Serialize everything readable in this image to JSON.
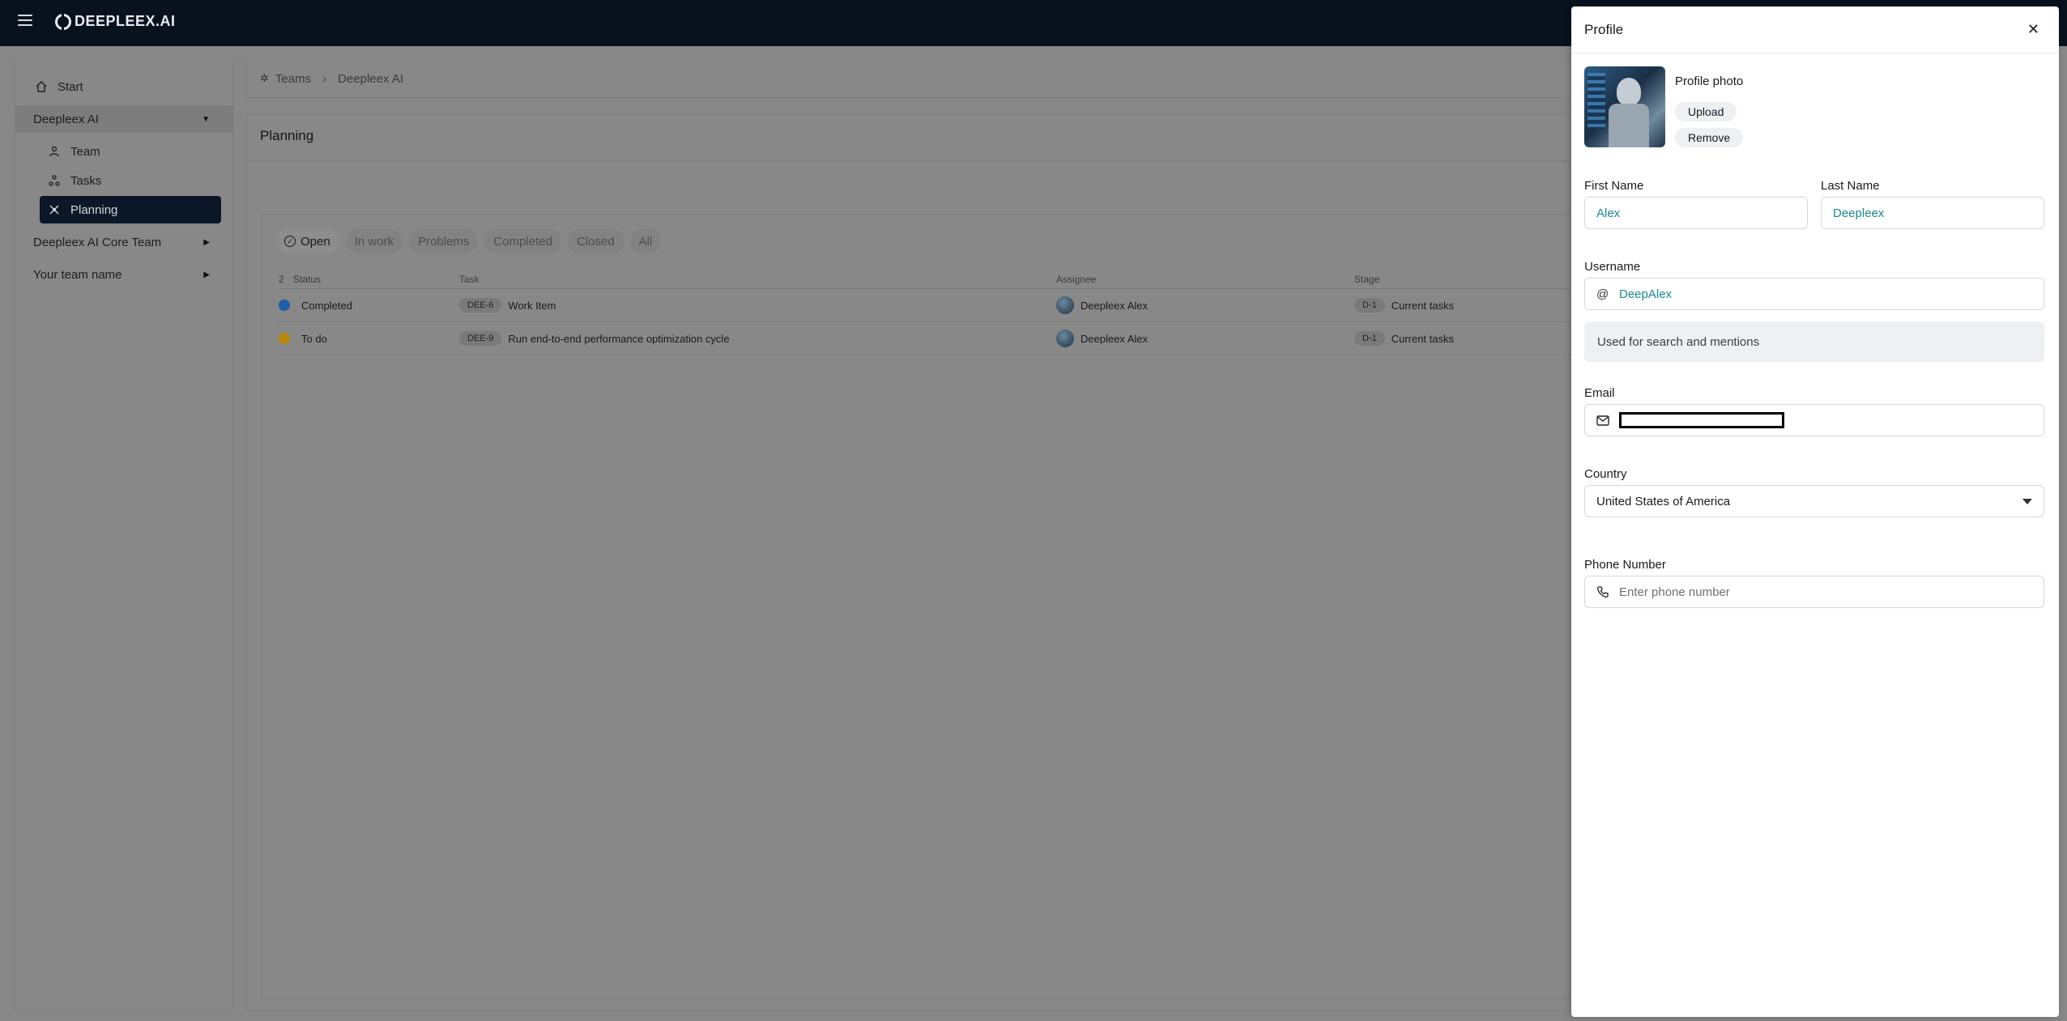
{
  "brand": {
    "name": "DEEPLEEX.AI"
  },
  "sidebar": {
    "items": [
      {
        "label": "Start",
        "icon": "home-icon"
      },
      {
        "label": "Deepleex AI",
        "icon": "caret-down-icon"
      },
      {
        "label": "Team",
        "icon": "team-icon"
      },
      {
        "label": "Tasks",
        "icon": "tasks-icon"
      },
      {
        "label": "Planning",
        "icon": "planning-icon"
      },
      {
        "label": "Deepleex AI Core Team",
        "icon": "caret-right-icon"
      },
      {
        "label": "Your team name",
        "icon": "caret-right-icon"
      }
    ]
  },
  "breadcrumb": {
    "root": "Teams",
    "current": "Deepleex AI"
  },
  "main": {
    "title": "Planning",
    "filters": [
      "Open",
      "In work",
      "Problems",
      "Completed",
      "Closed",
      "All"
    ],
    "table": {
      "count": "2",
      "headers": [
        "Status",
        "Task",
        "Assignee",
        "Stage"
      ],
      "rows": [
        {
          "status": "Completed",
          "key": "DEE-6",
          "task": "Work Item",
          "assignee": "Deepleex Alex",
          "stage_key": "D-1",
          "stage": "Current tasks",
          "status_color": "#1f5fa8"
        },
        {
          "status": "To do",
          "key": "DEE-9",
          "task": "Run end-to-end performance optimization cycle",
          "assignee": "Deepleex Alex",
          "stage_key": "D-1",
          "stage": "Current tasks",
          "status_color": "#b8860b"
        }
      ]
    }
  },
  "profile": {
    "title": "Profile",
    "photo_label": "Profile photo",
    "upload_label": "Upload",
    "remove_label": "Remove",
    "first_name_label": "First Name",
    "first_name": "Alex",
    "last_name_label": "Last Name",
    "last_name": "Deepleex",
    "username_label": "Username",
    "username": "DeepAlex",
    "username_hint": "Used for search and mentions",
    "email_label": "Email",
    "country_label": "Country",
    "country": "United States of America",
    "phone_label": "Phone Number",
    "phone_placeholder": "Enter phone number",
    "accent_color": "#1b8a8f"
  }
}
